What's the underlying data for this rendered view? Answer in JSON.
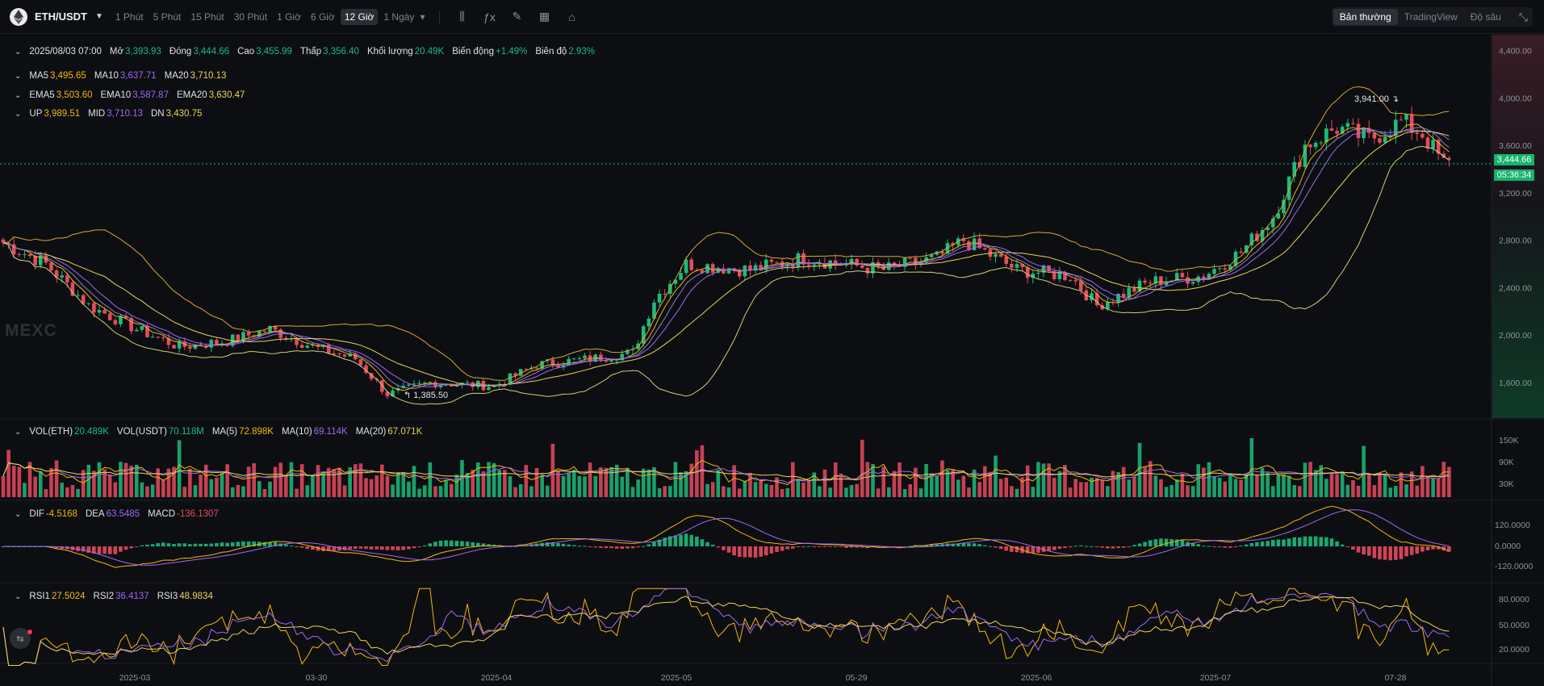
{
  "header": {
    "pair": "ETH/USDT",
    "timeframes": [
      "1 Phút",
      "5 Phút",
      "15 Phút",
      "30 Phút",
      "1 Giờ",
      "6 Giờ",
      "12 Giờ"
    ],
    "active_timeframe": "12 Giờ",
    "more_timeframe": "1 Ngày",
    "views": [
      "Bản thường",
      "TradingView",
      "Độ sâu"
    ],
    "active_view": "Bản thường"
  },
  "ohlc": [
    {
      "k": "2025/08/03 07:00",
      "v": ""
    },
    {
      "k": "Mở",
      "v": "3,393.93"
    },
    {
      "k": "Đóng",
      "v": "3,444.66"
    },
    {
      "k": "Cao",
      "v": "3,455.99"
    },
    {
      "k": "Thấp",
      "v": "3,356.40"
    },
    {
      "k": "Khối lượng",
      "v": "20.49K"
    },
    {
      "k": "Biến động",
      "v": "+1.49%"
    },
    {
      "k": "Biên độ",
      "v": "2.93%"
    }
  ],
  "ma": [
    {
      "k": "MA5",
      "v": "3,495.65",
      "color": "#f0b90b"
    },
    {
      "k": "MA10",
      "v": "3,637.71",
      "color": "#a069f2"
    },
    {
      "k": "MA20",
      "v": "3,710.13",
      "color": "#e8d35a"
    }
  ],
  "ema": [
    {
      "k": "EMA5",
      "v": "3,503.60",
      "color": "#f0b90b"
    },
    {
      "k": "EMA10",
      "v": "3,587.87",
      "color": "#a069f2"
    },
    {
      "k": "EMA20",
      "v": "3,630.47",
      "color": "#e8d35a"
    }
  ],
  "boll": [
    {
      "k": "UP",
      "v": "3,989.51",
      "color": "#f0b90b"
    },
    {
      "k": "MID",
      "v": "3,710.13",
      "color": "#a069f2"
    },
    {
      "k": "DN",
      "v": "3,430.75",
      "color": "#e8d35a"
    }
  ],
  "vol": [
    {
      "k": "VOL(ETH)",
      "v": "20.489K",
      "color": "#1cbb7a"
    },
    {
      "k": "VOL(USDT)",
      "v": "70.118M",
      "color": "#1cbb7a"
    },
    {
      "k": "MA(5)",
      "v": "72.898K",
      "color": "#f0b90b"
    },
    {
      "k": "MA(10)",
      "v": "69.114K",
      "color": "#a069f2"
    },
    {
      "k": "MA(20)",
      "v": "67.071K",
      "color": "#e8d35a"
    }
  ],
  "macd": [
    {
      "k": "DIF",
      "v": "-4.5168",
      "color": "#f0b90b"
    },
    {
      "k": "DEA",
      "v": "63.5485",
      "color": "#a069f2"
    },
    {
      "k": "MACD",
      "v": "-136.1307",
      "color": "#e84a5f"
    }
  ],
  "rsi": [
    {
      "k": "RSI1",
      "v": "27.5024",
      "color": "#f0b90b"
    },
    {
      "k": "RSI2",
      "v": "36.4137",
      "color": "#a069f2"
    },
    {
      "k": "RSI3",
      "v": "48.9834",
      "color": "#e8d35a"
    }
  ],
  "price_axis": [
    "4,400.00",
    "4,000.00",
    "3,600.00",
    "3,200.00",
    "2,800.00",
    "2,400.00",
    "2,000.00",
    "1,600.00"
  ],
  "vol_axis": [
    "150K",
    "90K",
    "30K"
  ],
  "macd_axis": [
    "120.0000",
    "0.0000",
    "-120.0000"
  ],
  "rsi_axis": [
    "80.0000",
    "50.0000",
    "20.0000"
  ],
  "date_axis": [
    "2025-03",
    "03-30",
    "2025-04",
    "2025-05",
    "05-29",
    "2025-06",
    "2025-07",
    "07-28"
  ],
  "last_price": "3,444.66",
  "countdown": "05:36:34",
  "high_label": "3,941.00",
  "low_label": "1,385.50",
  "watermark": "MEXC",
  "colors": {
    "up": "#1cbb7a",
    "down": "#e84a5f",
    "bg": "#0d0e12"
  },
  "chart_data": {
    "type": "candlestick",
    "approx_close_path": [
      [
        0,
        2780
      ],
      [
        8,
        2600
      ],
      [
        16,
        2250
      ],
      [
        25,
        2050
      ],
      [
        33,
        1900
      ],
      [
        42,
        1950
      ],
      [
        50,
        2050
      ],
      [
        58,
        1900
      ],
      [
        66,
        1800
      ],
      [
        72,
        1500
      ],
      [
        80,
        1600
      ],
      [
        92,
        1570
      ],
      [
        100,
        1750
      ],
      [
        110,
        1800
      ],
      [
        118,
        1850
      ],
      [
        122,
        2300
      ],
      [
        128,
        2600
      ],
      [
        140,
        2550
      ],
      [
        150,
        2650
      ],
      [
        165,
        2550
      ],
      [
        175,
        2650
      ],
      [
        180,
        2800
      ],
      [
        190,
        2550
      ],
      [
        200,
        2500
      ],
      [
        205,
        2250
      ],
      [
        215,
        2450
      ],
      [
        225,
        2500
      ],
      [
        232,
        2700
      ],
      [
        238,
        3000
      ],
      [
        244,
        3600
      ],
      [
        250,
        3750
      ],
      [
        256,
        3650
      ],
      [
        262,
        3800
      ],
      [
        266,
        3700
      ],
      [
        270,
        3445
      ]
    ],
    "ylim": [
      1300,
      4500
    ]
  }
}
